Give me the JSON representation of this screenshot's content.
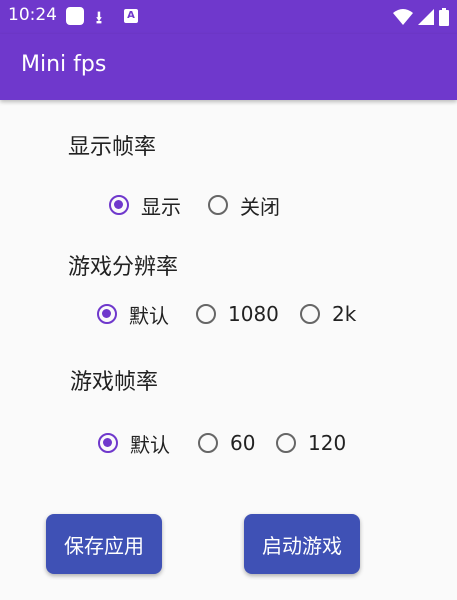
{
  "status_bar": {
    "time": "10:24",
    "icons": [
      "square-notification-icon",
      "download-icon",
      "a-badge-icon",
      "wifi-icon",
      "signal-icon",
      "battery-icon"
    ]
  },
  "app": {
    "title": "Mini fps"
  },
  "sections": {
    "display_fps": {
      "label": "显示帧率",
      "options": [
        "显示",
        "关闭"
      ],
      "selected": "显示"
    },
    "resolution": {
      "label": "游戏分辨率",
      "options": [
        "默认",
        "1080",
        "2k"
      ],
      "selected": "默认"
    },
    "game_fps": {
      "label": "游戏帧率",
      "options": [
        "默认",
        "60",
        "120"
      ],
      "selected": "默认"
    }
  },
  "buttons": {
    "save": "保存应用",
    "launch": "启动游戏"
  },
  "colors": {
    "primary": "#6f38cc",
    "button": "#3f51b5",
    "background": "#fafafa"
  }
}
